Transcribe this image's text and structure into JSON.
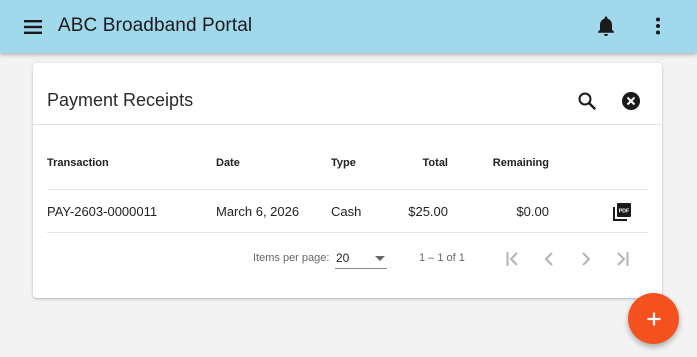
{
  "app": {
    "title": "ABC Broadband Portal",
    "toolbar_color": "#a0d8ec",
    "icons": [
      "menu-icon",
      "bell-icon",
      "more-vert-icon"
    ]
  },
  "card": {
    "title": "Payment Receipts",
    "icons": [
      "search-icon",
      "cancel-icon"
    ]
  },
  "table": {
    "headers": {
      "transaction": "Transaction",
      "date": "Date",
      "type": "Type",
      "total": "Total",
      "remaining": "Remaining"
    },
    "rows": [
      {
        "transaction": "PAY-2603-0000011",
        "date": "March 6, 2026",
        "type": "Cash",
        "total": "$25.00",
        "remaining": "$0.00",
        "action_icon": "pdf-icon"
      }
    ]
  },
  "paginator": {
    "items_per_page_label": "Items per page:",
    "page_size": "20",
    "range_label": "1 – 1 of 1",
    "icons": [
      "first-page-icon",
      "prev-page-icon",
      "next-page-icon",
      "last-page-icon"
    ]
  },
  "fab": {
    "icon": "add-icon",
    "color": "#f4511e"
  }
}
